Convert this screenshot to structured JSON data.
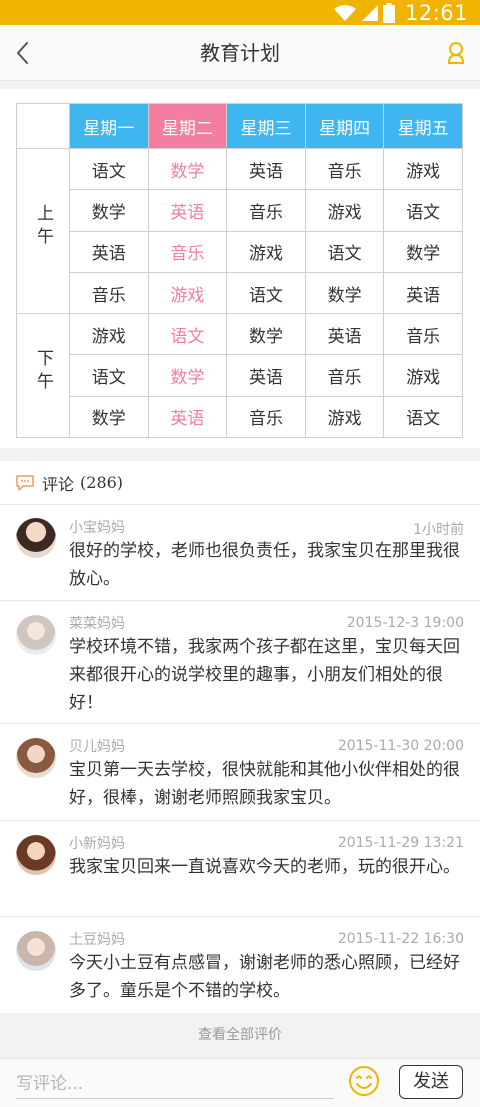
{
  "status_bar": {
    "time": "12:61"
  },
  "nav": {
    "title": "教育计划"
  },
  "schedule": {
    "days": [
      "星期一",
      "星期二",
      "星期三",
      "星期四",
      "星期五"
    ],
    "highlight_color": "#f47ea2",
    "header_color": "#3fb6ef",
    "morning_label": "上午",
    "afternoon_label": "下午",
    "rows": [
      [
        "语文",
        "数学",
        "英语",
        "音乐",
        "游戏"
      ],
      [
        "数学",
        "英语",
        "音乐",
        "游戏",
        "语文"
      ],
      [
        "英语",
        "音乐",
        "游戏",
        "语文",
        "数学"
      ],
      [
        "音乐",
        "游戏",
        "语文",
        "数学",
        "英语"
      ],
      [
        "游戏",
        "语文",
        "数学",
        "英语",
        "音乐"
      ],
      [
        "语文",
        "数学",
        "英语",
        "音乐",
        "游戏"
      ],
      [
        "数学",
        "英语",
        "音乐",
        "游戏",
        "语文"
      ]
    ]
  },
  "comments": {
    "label": "评论",
    "count": "(286)",
    "items": [
      {
        "name": "小宝妈妈",
        "time": "1小时前",
        "text": "很好的学校，老师也很负责任，我家宝贝在那里我很放心。",
        "avatar": "avatar-1"
      },
      {
        "name": "菜菜妈妈",
        "time": "2015-12-3 19:00",
        "text": "学校环境不错，我家两个孩子都在这里，宝贝每天回来都很开心的说学校里的趣事，小朋友们相处的很好！",
        "avatar": "avatar-2"
      },
      {
        "name": "贝儿妈妈",
        "time": "2015-11-30 20:00",
        "text": "宝贝第一天去学校，很快就能和其他小伙伴相处的很好，很棒，谢谢老师照顾我家宝贝。",
        "avatar": "avatar-3"
      },
      {
        "name": "小新妈妈",
        "time": "2015-11-29 13:21",
        "text": "我家宝贝回来一直说喜欢今天的老师，玩的很开心。",
        "avatar": "avatar-4"
      },
      {
        "name": "土豆妈妈",
        "time": "2015-11-22 16:30",
        "text": "今天小土豆有点感冒，谢谢老师的悉心照顾，已经好多了。童乐是个不错的学校。",
        "avatar": "avatar-5"
      }
    ]
  },
  "view_all": "查看全部评价",
  "input": {
    "placeholder": "写评论...",
    "send_label": "发送"
  }
}
